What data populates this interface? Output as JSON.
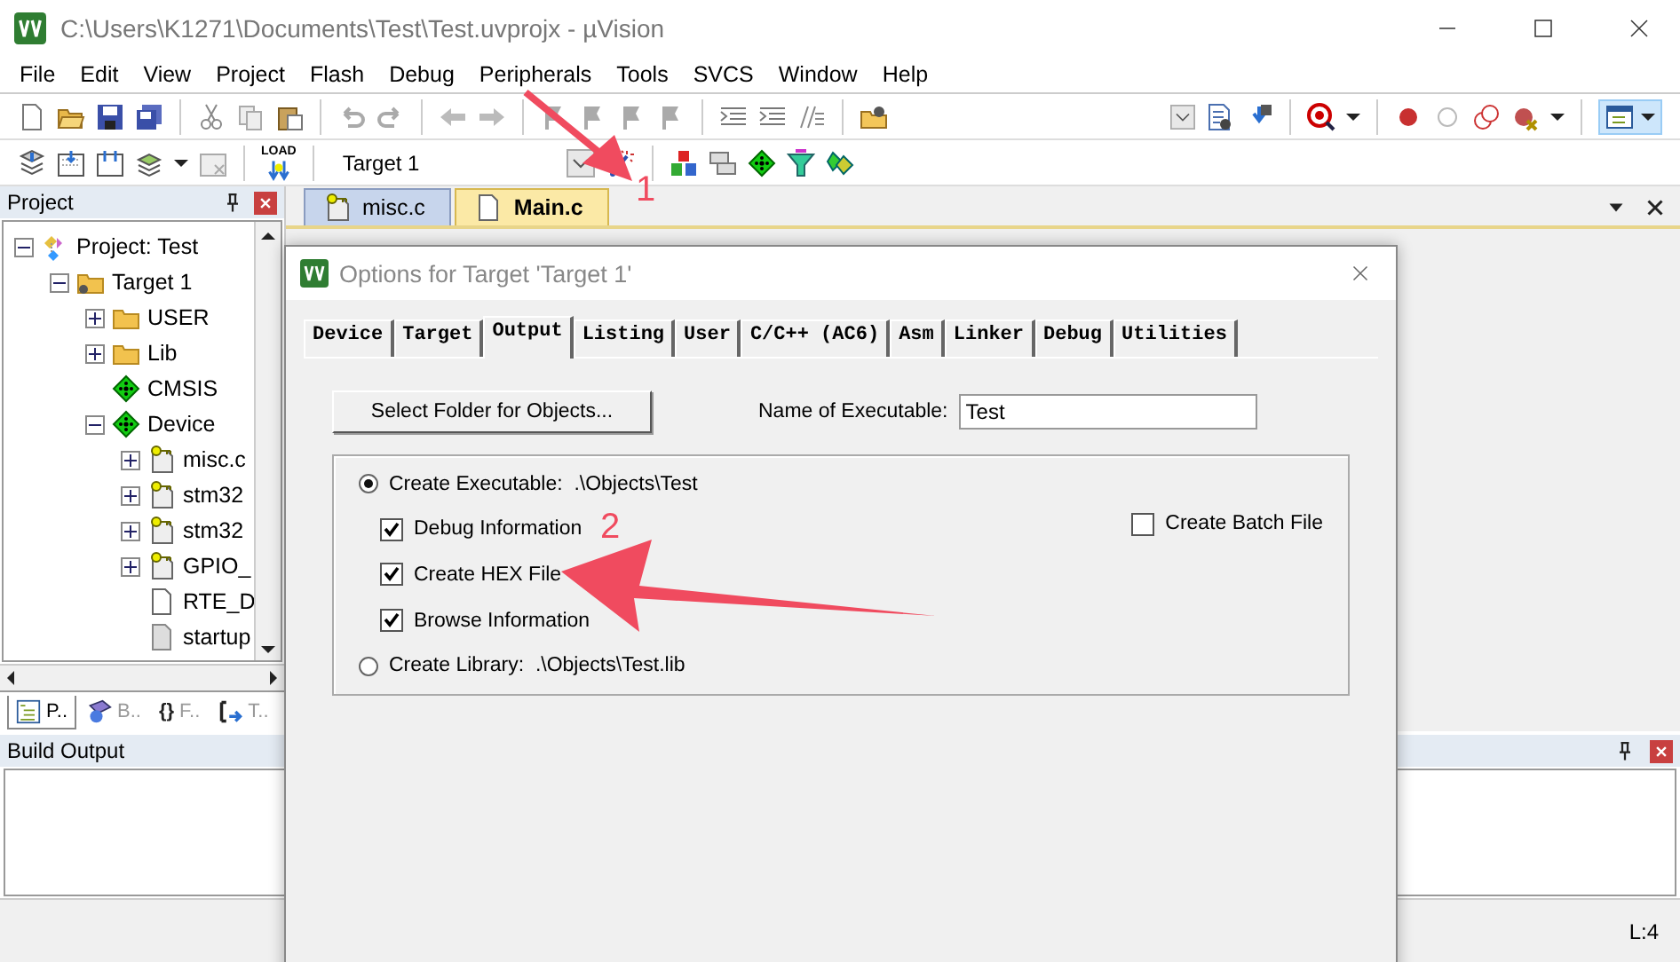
{
  "window": {
    "title": "C:\\Users\\K1271\\Documents\\Test\\Test.uvprojx - µVision"
  },
  "menu": [
    "File",
    "Edit",
    "View",
    "Project",
    "Flash",
    "Debug",
    "Peripherals",
    "Tools",
    "SVCS",
    "Window",
    "Help"
  ],
  "toolbar": {
    "target": "Target 1",
    "load_label": "LOAD"
  },
  "project_panel": {
    "title": "Project",
    "tree": [
      {
        "label": "Project: Test",
        "kind": "project",
        "expanded": true,
        "children": [
          {
            "label": "Target 1",
            "kind": "target",
            "expanded": true,
            "children": [
              {
                "label": "USER",
                "kind": "folder",
                "expanded": false
              },
              {
                "label": "Lib",
                "kind": "folder",
                "expanded": false
              },
              {
                "label": "CMSIS",
                "kind": "component"
              },
              {
                "label": "Device",
                "kind": "component",
                "expanded": true,
                "children": [
                  {
                    "label": "misc.c",
                    "kind": "key-file",
                    "expanded": false
                  },
                  {
                    "label": "stm32",
                    "kind": "key-file",
                    "expanded": false
                  },
                  {
                    "label": "stm32",
                    "kind": "key-file",
                    "expanded": false
                  },
                  {
                    "label": "GPIO_",
                    "kind": "key-file",
                    "expanded": false
                  },
                  {
                    "label": "RTE_D",
                    "kind": "file"
                  },
                  {
                    "label": "startup",
                    "kind": "asm-file"
                  }
                ]
              }
            ]
          }
        ]
      }
    ]
  },
  "panel_tabs": [
    {
      "label": "P..",
      "kind": "project",
      "selected": true
    },
    {
      "label": "B..",
      "kind": "books",
      "selected": false
    },
    {
      "label": "F..",
      "kind": "functions",
      "glyph": "{}",
      "selected": false
    },
    {
      "label": "T..",
      "kind": "templates",
      "selected": false
    }
  ],
  "editor_tabs": [
    {
      "label": "misc.c",
      "kind": "key-file",
      "selected": false
    },
    {
      "label": "Main.c",
      "kind": "file",
      "selected": true
    }
  ],
  "build_output": {
    "title": "Build Output"
  },
  "status_bar": {
    "position": "L:4"
  },
  "dialog": {
    "title": "Options for Target 'Target 1'",
    "tabs": [
      {
        "label": "Device",
        "selected": false
      },
      {
        "label": "Target",
        "selected": false
      },
      {
        "label": "Output",
        "selected": true
      },
      {
        "label": "Listing",
        "selected": false
      },
      {
        "label": "User",
        "selected": false
      },
      {
        "label": "C/C++ (AC6)",
        "selected": false
      },
      {
        "label": "Asm",
        "selected": false
      },
      {
        "label": "Linker",
        "selected": false
      },
      {
        "label": "Debug",
        "selected": false
      },
      {
        "label": "Utilities",
        "selected": false
      }
    ],
    "folder_button": "Select Folder for Objects...",
    "executable_name": {
      "label": "Name of Executable:",
      "value": "Test"
    },
    "create_executable": {
      "label": "Create Executable:",
      "path": ".\\Objects\\Test",
      "selected": true
    },
    "options": [
      {
        "label": "Debug Information",
        "checked": true
      },
      {
        "label": "Create HEX File",
        "checked": true
      },
      {
        "label": "Browse Information",
        "checked": true
      }
    ],
    "create_library": {
      "label": "Create Library:",
      "path": ".\\Objects\\Test.lib",
      "selected": false
    },
    "batch_file": {
      "label": "Create Batch File",
      "checked": false
    }
  },
  "annotations": [
    {
      "label": "1"
    },
    {
      "label": "2"
    }
  ]
}
